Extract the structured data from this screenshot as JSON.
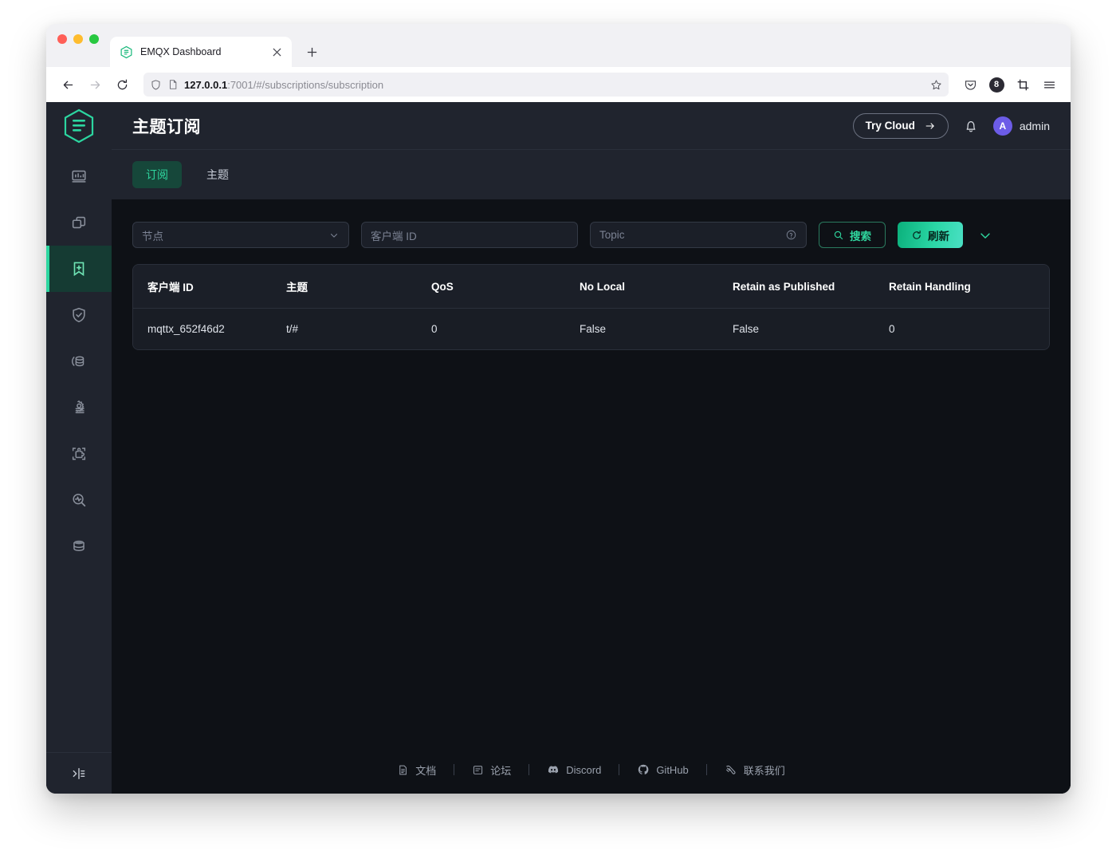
{
  "browser": {
    "tab": {
      "title": "EMQX Dashboard",
      "favicon_icon": "emqx-hexagon-icon",
      "close_icon": "close-icon"
    },
    "new_tab_label": "+",
    "nav": {
      "back_icon": "arrow-left-icon",
      "forward_icon": "arrow-right-icon",
      "reload_icon": "reload-icon",
      "shield_icon": "shield-icon",
      "page_icon": "page-document-icon",
      "bookmark_icon": "star-icon",
      "pocket_icon": "pocket-save-icon",
      "account_badge": "8",
      "extension_icon": "crop-extension-icon",
      "menu_icon": "hamburger-menu-icon"
    },
    "url": {
      "host": "127.0.0.1",
      "rest": ":7001/#/subscriptions/subscription"
    }
  },
  "sidebar": {
    "logo_icon": "emqx-hexagon-logo",
    "items": [
      {
        "name": "dashboard",
        "icon": "chart-bars-icon",
        "active": false
      },
      {
        "name": "clients",
        "icon": "stacked-windows-icon",
        "active": false
      },
      {
        "name": "subscriptions",
        "icon": "bookmark-plus-icon",
        "active": true
      },
      {
        "name": "access-control",
        "icon": "shield-check-icon",
        "active": false
      },
      {
        "name": "data-integration",
        "icon": "database-refresh-icon",
        "active": false
      },
      {
        "name": "rules-engine",
        "icon": "gear-flow-icon",
        "active": false
      },
      {
        "name": "extensions",
        "icon": "puzzle-piece-icon",
        "active": false
      },
      {
        "name": "diagnose",
        "icon": "pulse-magnifier-icon",
        "active": false
      },
      {
        "name": "management",
        "icon": "database-stack-icon",
        "active": false
      }
    ],
    "collapse_icon": "collapse-sidebar-icon"
  },
  "header": {
    "title": "主题订阅",
    "try_cloud_label": "Try Cloud",
    "try_cloud_arrow_icon": "arrow-right-icon",
    "bell_icon": "bell-notification-icon",
    "avatar_initial": "A",
    "avatar_color": "#6c5ce7",
    "user_name": "admin"
  },
  "tabs": [
    {
      "label": "订阅",
      "active": true
    },
    {
      "label": "主题",
      "active": false
    }
  ],
  "filters": {
    "node_placeholder": "节点",
    "node_chevron_icon": "chevron-down-icon",
    "clientid_placeholder": "客户端 ID",
    "topic_placeholder": "Topic",
    "topic_help_icon": "question-circle-icon",
    "search_label": "搜索",
    "search_icon": "search-icon",
    "refresh_label": "刷新",
    "refresh_icon": "refresh-icon",
    "more_chevron_icon": "chevron-down-icon",
    "accent_color": "#2fd69e"
  },
  "table": {
    "columns": [
      "客户端 ID",
      "主题",
      "QoS",
      "No Local",
      "Retain as Published",
      "Retain Handling"
    ],
    "rows": [
      {
        "client_id": "mqttx_652f46d2",
        "topic": "t/#",
        "qos": "0",
        "no_local": "False",
        "retain_as_published": "False",
        "retain_handling": "0"
      }
    ]
  },
  "footer": {
    "links": [
      {
        "label": "文档",
        "icon": "document-icon"
      },
      {
        "label": "论坛",
        "icon": "forum-icon"
      },
      {
        "label": "Discord",
        "icon": "discord-icon"
      },
      {
        "label": "GitHub",
        "icon": "github-icon"
      },
      {
        "label": "联系我们",
        "icon": "contact-icon"
      }
    ]
  }
}
